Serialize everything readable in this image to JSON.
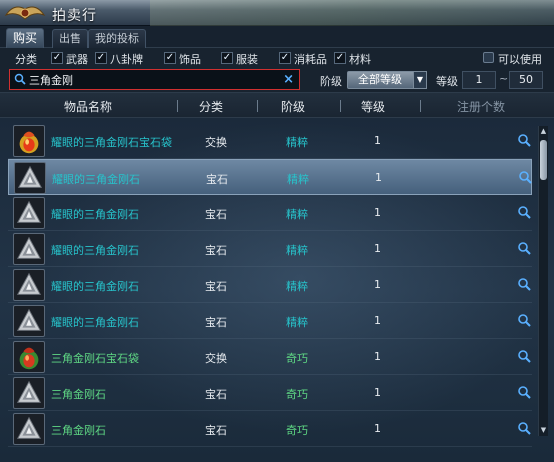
{
  "window": {
    "title": "拍卖行"
  },
  "tabs": [
    {
      "label": "购买",
      "active": true
    },
    {
      "label": "出售",
      "active": false
    },
    {
      "label": "我的投标",
      "active": false
    }
  ],
  "filters": {
    "category_label": "分类",
    "options": [
      {
        "label": "武器",
        "checked": true
      },
      {
        "label": "八卦牌",
        "checked": true
      },
      {
        "label": "饰品",
        "checked": true
      },
      {
        "label": "服装",
        "checked": true
      },
      {
        "label": "消耗品",
        "checked": true
      },
      {
        "label": "材料",
        "checked": true
      }
    ],
    "usable_label": "可以使用"
  },
  "search": {
    "value": "三角金刚",
    "clear_icon": "×",
    "grade_label": "阶级",
    "grade_select": "全部等级",
    "level_label": "等级",
    "level_min": "1",
    "level_sep": "~",
    "level_max": "50"
  },
  "columns": {
    "name": "物品名称",
    "category": "分类",
    "grade": "阶级",
    "level": "等级",
    "count": "注册个数"
  },
  "colors": {
    "teal_name": "#27c4cc",
    "green_name": "#5fd884",
    "search_highlight": "#d13030"
  },
  "items": [
    {
      "name": "耀眼的三角金刚石宝石袋",
      "category": "交换",
      "grade": "精粹",
      "level": "1",
      "icon": "gem-pouch-icon"
    },
    {
      "name": "耀眼的三角金刚石",
      "category": "宝石",
      "grade": "精粹",
      "level": "1",
      "icon": "diamond-gem-icon"
    },
    {
      "name": "耀眼的三角金刚石",
      "category": "宝石",
      "grade": "精粹",
      "level": "1",
      "icon": "diamond-gem-icon"
    },
    {
      "name": "耀眼的三角金刚石",
      "category": "宝石",
      "grade": "精粹",
      "level": "1",
      "icon": "diamond-gem-icon"
    },
    {
      "name": "耀眼的三角金刚石",
      "category": "宝石",
      "grade": "精粹",
      "level": "1",
      "icon": "diamond-gem-icon"
    },
    {
      "name": "耀眼的三角金刚石",
      "category": "宝石",
      "grade": "精粹",
      "level": "1",
      "icon": "diamond-gem-icon"
    },
    {
      "name": "三角金刚石宝石袋",
      "category": "交换",
      "grade": "奇巧",
      "level": "1",
      "icon": "gem-pouch-icon"
    },
    {
      "name": "三角金刚石",
      "category": "宝石",
      "grade": "奇巧",
      "level": "1",
      "icon": "diamond-gem-icon"
    },
    {
      "name": "三角金刚石",
      "category": "宝石",
      "grade": "奇巧",
      "level": "1",
      "icon": "diamond-gem-icon"
    }
  ]
}
